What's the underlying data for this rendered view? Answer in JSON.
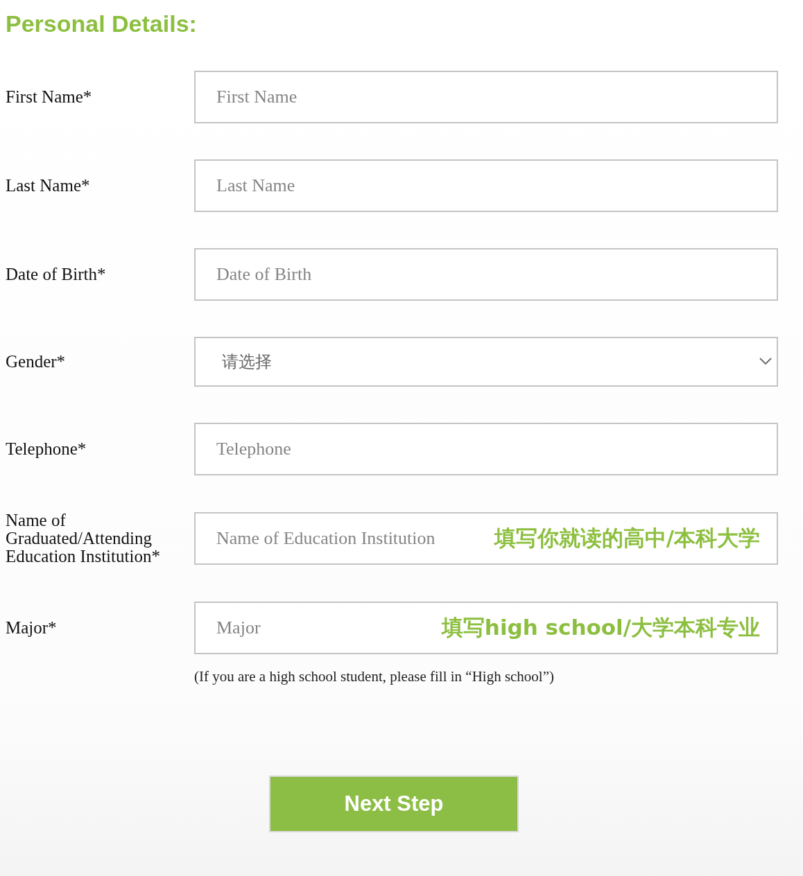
{
  "heading": "Personal Details:",
  "fields": [
    {
      "kind": "text",
      "label": "First Name*",
      "placeholder": "First Name"
    },
    {
      "kind": "text",
      "label": "Last Name*",
      "placeholder": "Last Name"
    },
    {
      "kind": "text",
      "label": "Date of Birth*",
      "placeholder": "Date of Birth"
    },
    {
      "kind": "select",
      "label": "Gender*",
      "value": "请选择"
    },
    {
      "kind": "text",
      "label": "Telephone*",
      "placeholder": "Telephone"
    },
    {
      "kind": "text",
      "label": "Name of Graduated/Attending Education Institution*",
      "placeholder": "Name of Education Institution",
      "annotation": "填写你就读的高中/本科大学"
    },
    {
      "kind": "text",
      "label": "Major*",
      "placeholder": "Major",
      "annotation": "填写high school/大学本科专业"
    }
  ],
  "note": "(If you are a high school student, please fill in “High school”)",
  "button": "Next Step"
}
